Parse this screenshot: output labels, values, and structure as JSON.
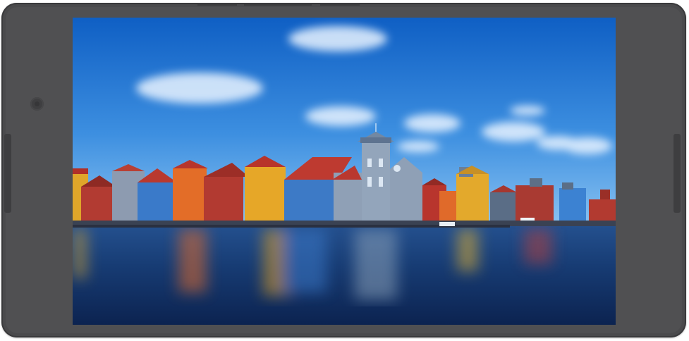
{
  "device": {
    "type": "tablet",
    "orientation": "landscape",
    "body_color": "#4a4a4c"
  },
  "screen": {
    "content": "wallpaper-image",
    "colors": {
      "sky_top": "#1266c9",
      "sky_bottom": "#6fb3ef",
      "water_top": "#1a3e79",
      "water_bottom": "#0d2653"
    }
  }
}
